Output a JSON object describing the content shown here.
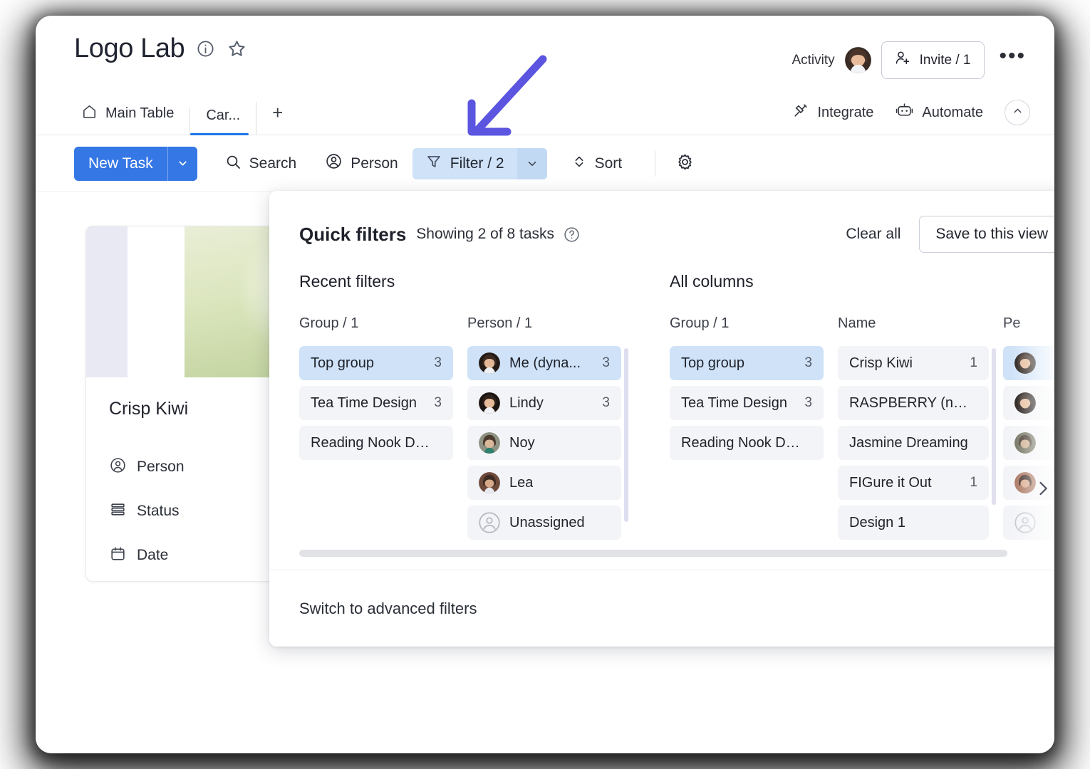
{
  "header": {
    "board_title": "Logo Lab",
    "info_icon": "info-circle-icon",
    "favorite_icon": "star-icon",
    "activity_label": "Activity",
    "avatar_name": "user-avatar",
    "invite_label": "Invite / 1",
    "invite_icon": "add-person-icon",
    "more_label": "•••"
  },
  "tabs": {
    "items": [
      {
        "label": "Main Table",
        "icon": "home-icon",
        "active": false
      },
      {
        "label": "Car...",
        "icon": "",
        "active": true
      }
    ],
    "add_label": "+",
    "right_items": [
      {
        "label": "Integrate",
        "icon": "integrate-icon"
      },
      {
        "label": "Automate",
        "icon": "robot-icon"
      }
    ],
    "collapse_icon": "chevron-up-icon"
  },
  "toolbar": {
    "new_task_label": "New Task",
    "new_task_caret": "chevron-down-icon",
    "search_label": "Search",
    "person_label": "Person",
    "filter_label": "Filter / 2",
    "filter_caret": "chevron-down-icon",
    "sort_label": "Sort",
    "settings_icon": "gear-icon"
  },
  "card": {
    "title": "Crisp Kiwi",
    "fields": [
      {
        "label": "Person",
        "icon": "person-circle-icon"
      },
      {
        "label": "Status",
        "icon": "status-lines-icon"
      },
      {
        "label": "Date",
        "icon": "calendar-icon"
      }
    ]
  },
  "quick_filters": {
    "title": "Quick filters",
    "subtitle": "Showing 2 of 8 tasks",
    "help_icon": "question-circle-icon",
    "clear_all_label": "Clear all",
    "save_view_label": "Save to this view",
    "advanced_link": "Switch to advanced filters",
    "next_icon": "chevron-right-icon",
    "sections": [
      {
        "title": "Recent filters",
        "columns": [
          {
            "header": "Group / 1",
            "options": [
              {
                "label": "Top group",
                "count": "3",
                "selected": true
              },
              {
                "label": "Tea Time Design",
                "count": "3",
                "selected": false
              },
              {
                "label": "Reading Nook De...",
                "count": "",
                "selected": false
              }
            ]
          },
          {
            "header": "Person / 1",
            "scroll": true,
            "options": [
              {
                "label": "Me (dyna...",
                "count": "3",
                "selected": true,
                "avatar": "avatar-me"
              },
              {
                "label": "Lindy",
                "count": "3",
                "selected": false,
                "avatar": "avatar-lindy"
              },
              {
                "label": "Noy",
                "count": "",
                "selected": false,
                "avatar": "avatar-noy"
              },
              {
                "label": "Lea",
                "count": "",
                "selected": false,
                "avatar": "avatar-lea"
              },
              {
                "label": "Unassigned",
                "count": "",
                "selected": false,
                "avatar": "avatar-unassigned"
              }
            ]
          }
        ]
      },
      {
        "title": "All columns",
        "columns": [
          {
            "header": "Group / 1",
            "options": [
              {
                "label": "Top group",
                "count": "3",
                "selected": true
              },
              {
                "label": "Tea Time Design",
                "count": "3",
                "selected": false
              },
              {
                "label": "Reading Nook De...",
                "count": "",
                "selected": false
              }
            ]
          },
          {
            "header": "Name",
            "scroll": true,
            "options": [
              {
                "label": "Crisp Kiwi",
                "count": "1",
                "selected": false
              },
              {
                "label": "RASPBERRY (n)l...",
                "count": "",
                "selected": false
              },
              {
                "label": "Jasmine Dreaming",
                "count": "",
                "selected": false
              },
              {
                "label": "FIGure it Out",
                "count": "1",
                "selected": false
              },
              {
                "label": "Design 1",
                "count": "",
                "selected": false
              }
            ]
          },
          {
            "header": "Pe",
            "clipped": true,
            "options": [
              {
                "label": "",
                "count": "",
                "selected": true,
                "avatar": "avatar-me"
              },
              {
                "label": "",
                "count": "",
                "selected": false,
                "avatar": "avatar-lindy"
              },
              {
                "label": "",
                "count": "",
                "selected": false,
                "avatar": "avatar-noy"
              },
              {
                "label": "",
                "count": "",
                "selected": false,
                "avatar": "avatar-lea"
              },
              {
                "label": "",
                "count": "",
                "selected": false,
                "avatar": "avatar-unassigned"
              }
            ]
          }
        ]
      }
    ]
  },
  "colors": {
    "primary_blue": "#3577e5",
    "chip_blue": "#cfe2f8",
    "panel_bg": "#ffffff",
    "option_bg": "#f3f4f7",
    "annotation_purple": "#5b55e0",
    "status_purple": "#a391ec"
  }
}
